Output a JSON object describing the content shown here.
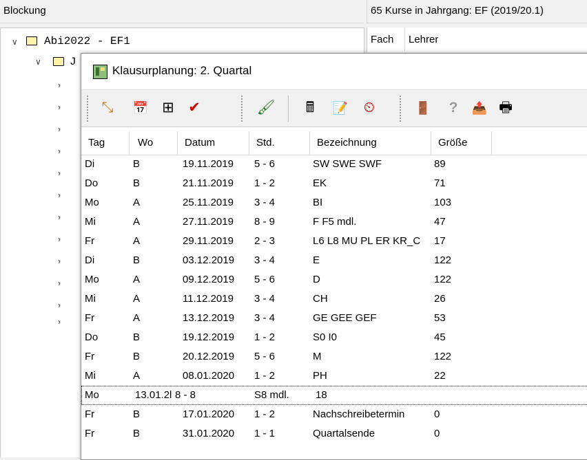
{
  "background": {
    "left_header": "Blockung",
    "right_header": "65 Kurse in Jahrgang: EF (2019/20.1)",
    "col_fach": "Fach",
    "col_lehrer": "Lehrer",
    "tree_root": "Abi2022 - EF1",
    "tree_child_partial": "J"
  },
  "dialog": {
    "title": "Klausurplanung: 2. Quartal",
    "toolbar": [
      {
        "name": "pointer-tool-icon",
        "glyph": "⤡"
      },
      {
        "name": "calendar-icon",
        "glyph": "📅"
      },
      {
        "name": "number-grid-icon",
        "glyph": "⊞"
      },
      {
        "name": "checkmark-icon",
        "glyph": "✔"
      },
      {
        "name": "wizard-icon",
        "glyph": "🖌"
      },
      {
        "name": "calculator-icon",
        "glyph": "🖩"
      },
      {
        "name": "document-edit-icon",
        "glyph": "📝"
      },
      {
        "name": "clock-icon",
        "glyph": "⏲"
      },
      {
        "name": "exit-door-icon",
        "glyph": "🚪"
      },
      {
        "name": "help-icon",
        "glyph": "?"
      },
      {
        "name": "export-icon",
        "glyph": "📤"
      },
      {
        "name": "printer-icon",
        "glyph": "🖶"
      }
    ],
    "columns": [
      "Tag",
      "Wo",
      "Datum",
      "Std.",
      "Bezeichnung",
      "Größe"
    ],
    "rows": [
      [
        "Di",
        "B",
        "19.11.2019",
        "5 - 6",
        "SW SWE SWF",
        "89"
      ],
      [
        "Do",
        "B",
        "21.11.2019",
        "1 - 2",
        "EK",
        "71"
      ],
      [
        "Mo",
        "A",
        "25.11.2019",
        "3 - 4",
        "BI",
        "103"
      ],
      [
        "Mi",
        "A",
        "27.11.2019",
        "8 - 9",
        "F F5 mdl.",
        "47"
      ],
      [
        "Fr",
        "A",
        "29.11.2019",
        "2 - 3",
        "L6 L8 MU PL ER KR_C",
        "17"
      ],
      [
        "Di",
        "B",
        "03.12.2019",
        "3 - 4",
        "E",
        "122"
      ],
      [
        "Mo",
        "A",
        "09.12.2019",
        "5 - 6",
        "D",
        "122"
      ],
      [
        "Mi",
        "A",
        "11.12.2019",
        "3 - 4",
        "CH",
        "26"
      ],
      [
        "Fr",
        "A",
        "13.12.2019",
        "3 - 4",
        "GE GEE GEF",
        "53"
      ],
      [
        "Do",
        "B",
        "19.12.2019",
        "1 - 2",
        "S0 I0",
        "45"
      ],
      [
        "Fr",
        "B",
        "20.12.2019",
        "5 - 6",
        "M",
        "122"
      ],
      [
        "Mi",
        "A",
        "08.01.2020",
        "1 - 2",
        "PH",
        "22"
      ]
    ],
    "editing_row": {
      "tag": "Mo",
      "datum": "13.01.2l",
      "std": "8 - 8",
      "bezeichnung": "S8 mdl.",
      "groesse": "18"
    },
    "rows_after": [
      [
        "Fr",
        "B",
        "17.01.2020",
        "1 - 2",
        "Nachschreibetermin",
        "0"
      ],
      [
        "Fr",
        "B",
        "31.01.2020",
        "1 - 1",
        "Quartalsende",
        "0"
      ]
    ]
  }
}
